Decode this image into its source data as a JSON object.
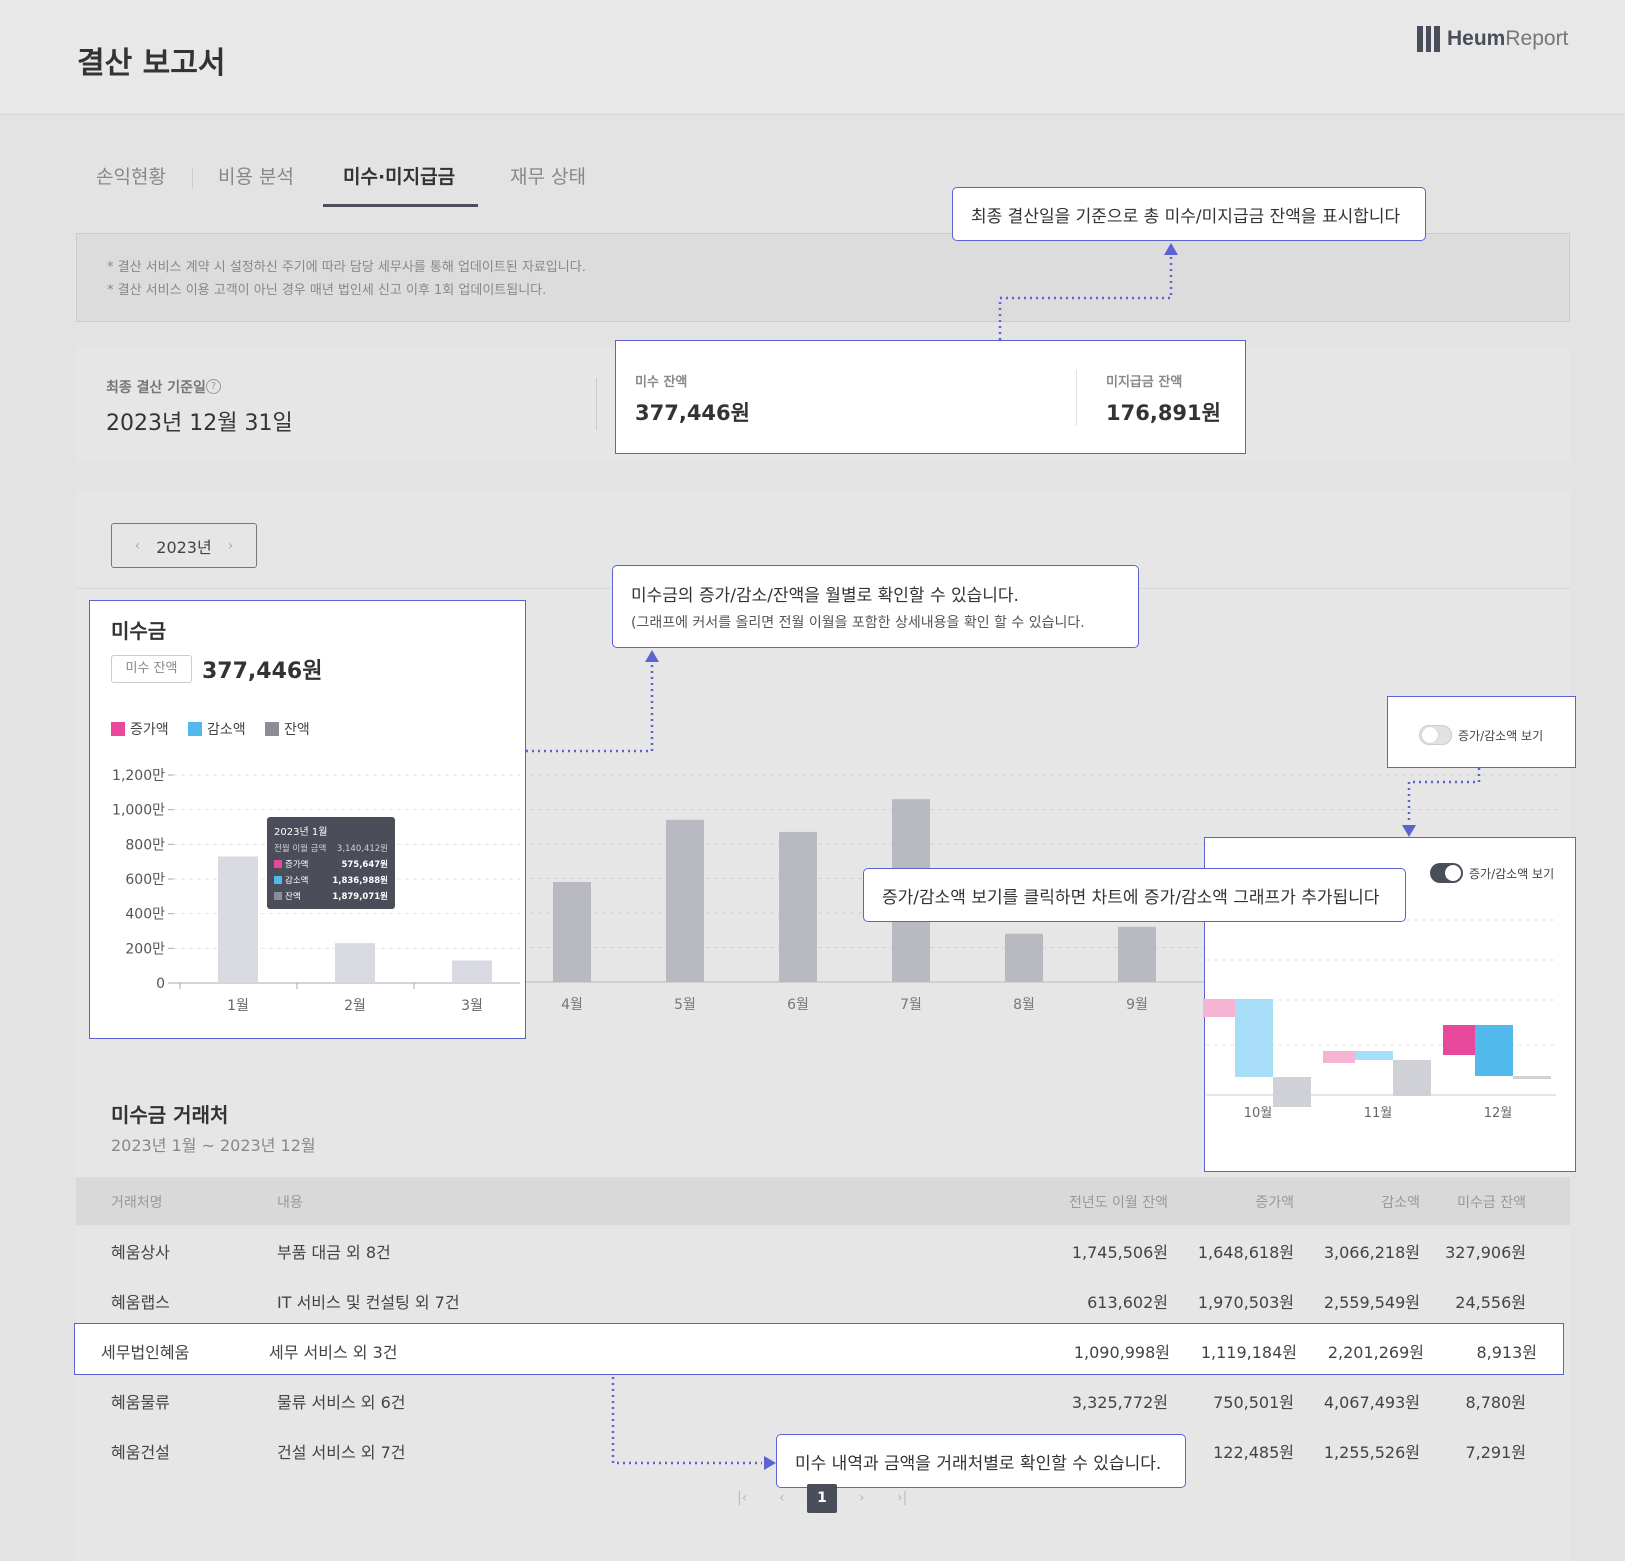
{
  "header": {
    "title": "결산 보고서",
    "brand_bold": "Heum",
    "brand_light": "Report"
  },
  "tabs": [
    {
      "label": "손익현황"
    },
    {
      "label": "비용 분석"
    },
    {
      "label": "미수·미지급금"
    },
    {
      "label": "재무 상태"
    }
  ],
  "notice": [
    "* 결산 서비스 계약 시 설정하신 주기에 따라 담당 세무사를 통해 업데이트된 자료입니다.",
    "* 결산 서비스 이용 고객이 아닌 경우 매년 법인세 신고 이후 1회 업데이트됩니다."
  ],
  "summary": {
    "close_label": "최종 결산 기준일",
    "help_icon": "?",
    "close_date": "2023년 12월 31일",
    "receivable_label": "미수 잔액",
    "receivable_value": "377,446원",
    "payable_label": "미지급금 잔액",
    "payable_value": "176,891원"
  },
  "year_selector": {
    "prev": "‹",
    "year": "2023년",
    "next": "›"
  },
  "chart_card": {
    "title": "미수금",
    "badge": "미수 잔액",
    "amount": "377,446원",
    "legend": [
      "증가액",
      "감소액",
      "잔액"
    ],
    "legend_colors": [
      "#e8489b",
      "#52b9ec",
      "#8a8d97"
    ]
  },
  "toggle": {
    "label": "증가/감소액 보기"
  },
  "tooltip": {
    "title": "2023년 1월",
    "rows": [
      {
        "key": "전월 이월 금액",
        "val": "3,140,412원"
      },
      {
        "key": "증가액",
        "val": "575,647원"
      },
      {
        "key": "감소액",
        "val": "1,836,988원"
      },
      {
        "key": "잔액",
        "val": "1,879,071원"
      }
    ]
  },
  "chart_data": {
    "type": "bar",
    "categories": [
      "1월",
      "2월",
      "3월",
      "4월",
      "5월",
      "6월",
      "7월",
      "8월",
      "9월",
      "10월",
      "11월",
      "12월"
    ],
    "series": [
      {
        "name": "잔액",
        "values": [
          730,
          230,
          130,
          580,
          940,
          870,
          1060,
          280,
          320,
          null,
          null,
          null
        ]
      }
    ],
    "y_ticks": [
      "0",
      "200만",
      "400만",
      "600만",
      "800만",
      "1,000만",
      "1,200만"
    ],
    "ylim": [
      0,
      1200
    ],
    "unit": "만",
    "grid": true,
    "legend_position": "top-left"
  },
  "detail_chart_data": {
    "type": "bar",
    "categories": [
      "10월",
      "11월",
      "12월"
    ],
    "series": [
      {
        "name": "증가액",
        "values": [
          0.6,
          0.4,
          1.0
        ]
      },
      {
        "name": "감소액",
        "values": [
          2.6,
          0.3,
          1.7
        ]
      },
      {
        "name": "잔액",
        "values": [
          1.0,
          1.2,
          0.1
        ]
      }
    ]
  },
  "callouts": {
    "balance": "최종 결산일을 기준으로 총 미수/미지급금 잔액을 표시합니다",
    "chart_l1": "미수금의 증가/감소/잔액을 월별로 확인할 수 있습니다.",
    "chart_l2": "(그래프에 커서를 올리면 전월 이월을 포함한 상세내용을 확인 할 수 있습니다.",
    "toggle": "증가/감소액 보기를 클릭하면 차트에 증가/감소액 그래프가 추가됩니다",
    "table": "미수 내역과 금액을 거래처별로 확인할 수 있습니다."
  },
  "table": {
    "title": "미수금 거래처",
    "period": "2023년 1월 ~ 2023년 12월",
    "headers": [
      "거래처명",
      "내용",
      "전년도 이월 잔액",
      "증가액",
      "감소액",
      "미수금 잔액"
    ],
    "rows": [
      [
        "혜움상사",
        "부품 대금 외 8건",
        "1,745,506원",
        "1,648,618원",
        "3,066,218원",
        "327,906원"
      ],
      [
        "혜움랩스",
        "IT 서비스 및 컨설팅 외 7건",
        "613,602원",
        "1,970,503원",
        "2,559,549원",
        "24,556원"
      ],
      [
        "세무법인혜움",
        "세무 서비스 외 3건",
        "1,090,998원",
        "1,119,184원",
        "2,201,269원",
        "8,913원"
      ],
      [
        "혜움물류",
        "물류 서비스 외 6건",
        "3,325,772원",
        "750,501원",
        "4,067,493원",
        "8,780원"
      ],
      [
        "혜움건설",
        "건설 서비스 외 7건",
        "",
        "122,485원",
        "1,255,526원",
        "7,291원"
      ]
    ]
  },
  "pagination": {
    "first": "|‹",
    "prev": "‹",
    "current": "1",
    "next": "›",
    "last": "›|"
  }
}
